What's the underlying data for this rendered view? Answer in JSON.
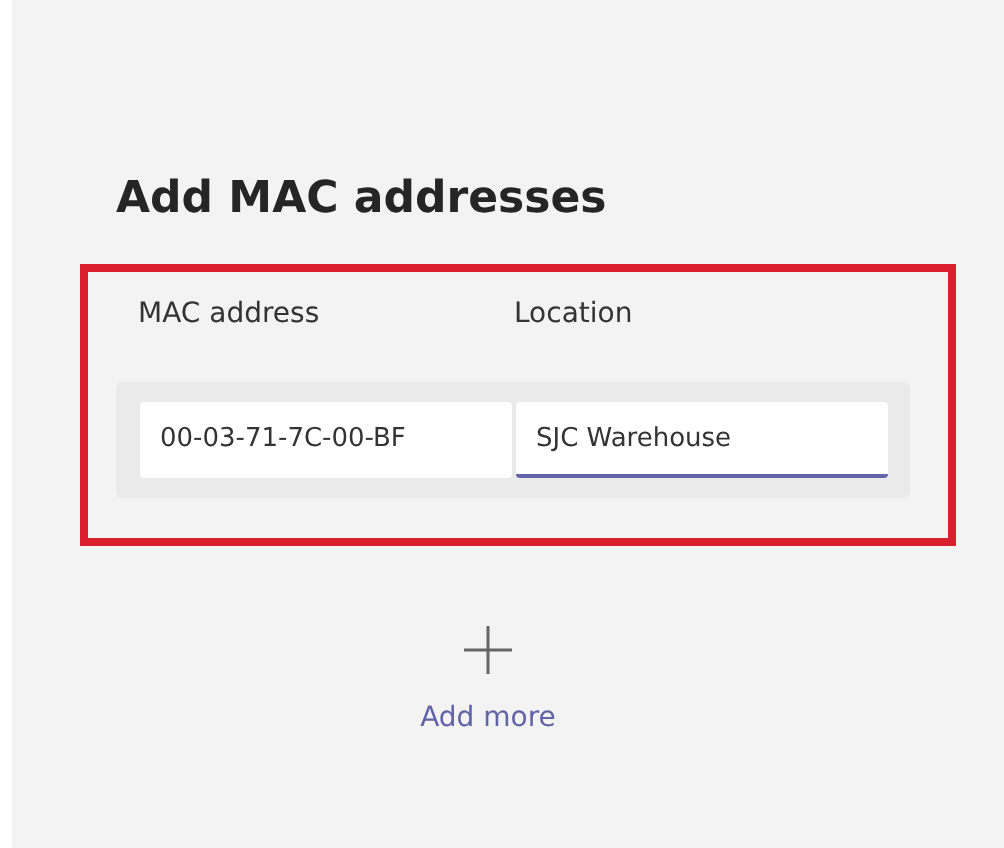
{
  "title": "Add MAC addresses",
  "columns": [
    "MAC address",
    "Location"
  ],
  "fields": [
    {
      "value": "00-03-71-7C-00-BF",
      "focused": false
    },
    {
      "value": "SJC Warehouse",
      "focused": true
    }
  ],
  "add_more": {
    "label": "Add more"
  }
}
